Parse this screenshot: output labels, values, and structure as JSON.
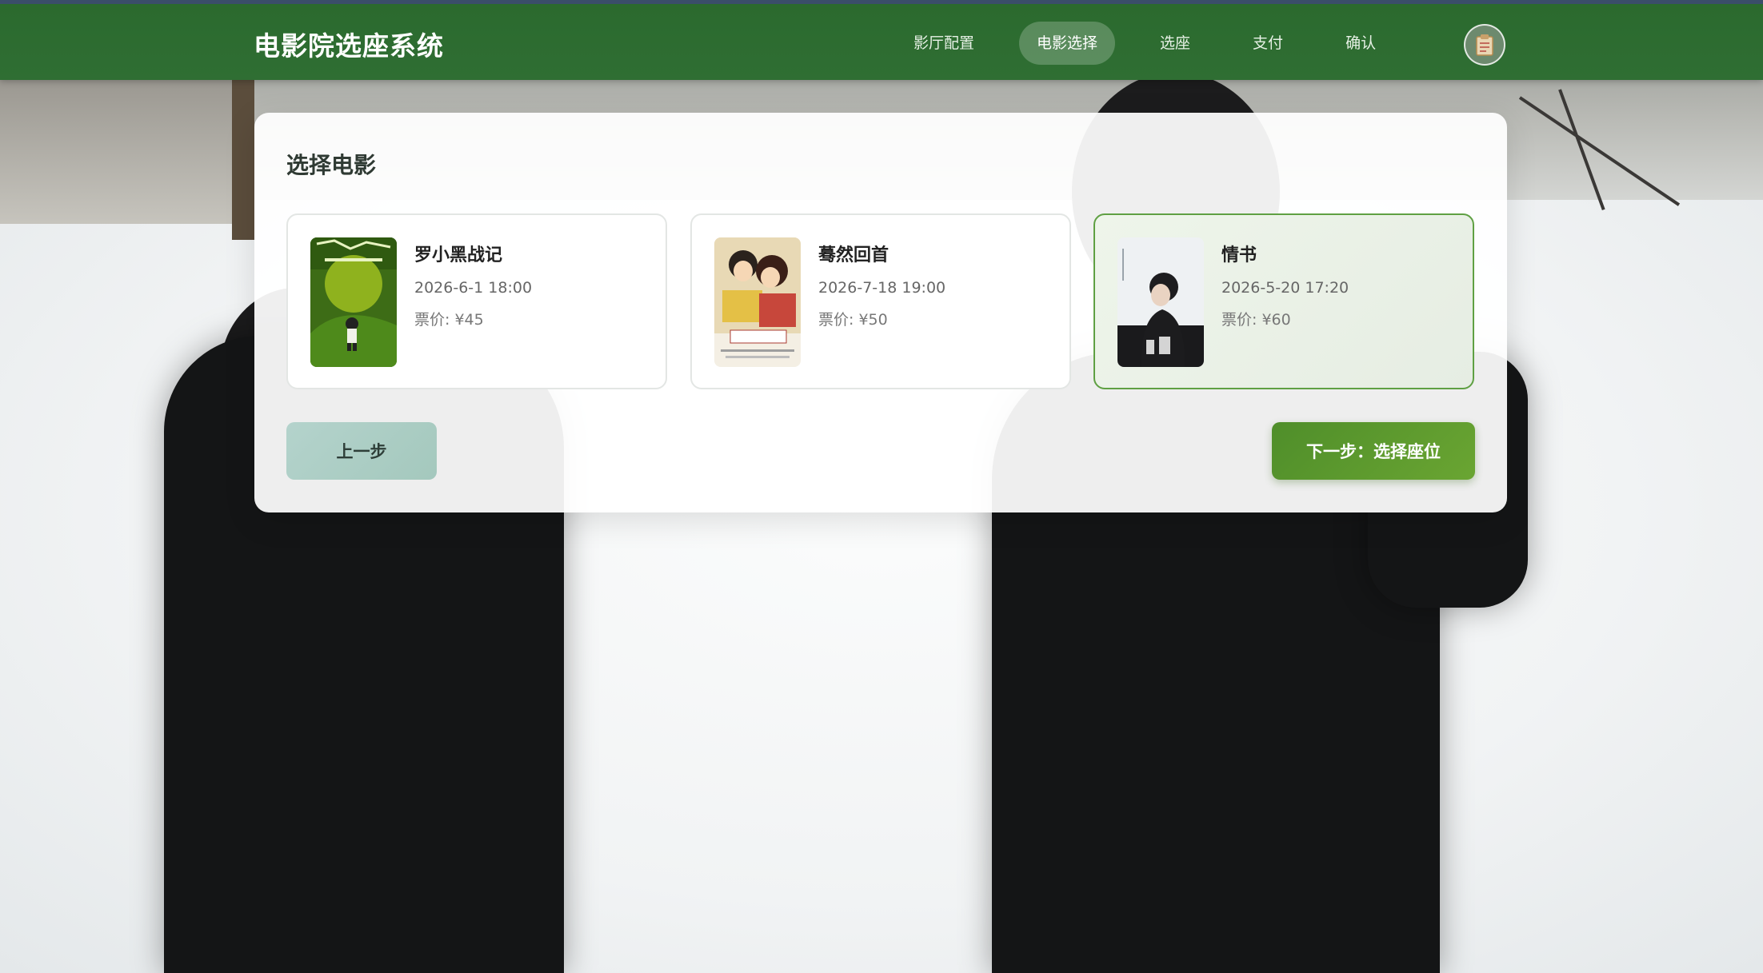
{
  "app": {
    "title": "电影院选座系统"
  },
  "nav": {
    "items": [
      {
        "label": "影厅配置",
        "active": false
      },
      {
        "label": "电影选择",
        "active": true
      },
      {
        "label": "选座",
        "active": false
      },
      {
        "label": "支付",
        "active": false
      },
      {
        "label": "确认",
        "active": false
      }
    ],
    "avatar_icon": "clipboard-icon"
  },
  "main": {
    "title": "选择电影",
    "movies": [
      {
        "title": "罗小黑战记",
        "time": "2026-6-1 18:00",
        "price": "票价: ¥45",
        "selected": false,
        "poster_icon": "poster-image"
      },
      {
        "title": "蓦然回首",
        "time": "2026-7-18 19:00",
        "price": "票价: ¥50",
        "selected": false,
        "poster_icon": "poster-image"
      },
      {
        "title": "情书",
        "time": "2026-5-20 17:20",
        "price": "票价: ¥60",
        "selected": true,
        "poster_icon": "poster-image"
      }
    ],
    "prev_label": "上一步",
    "next_label": "下一步：选择座位"
  },
  "colors": {
    "nav_bg": "#2f6e33",
    "accent": "#5fa043",
    "next_button": "#5a9a2e",
    "prev_button": "#aecdc5"
  }
}
